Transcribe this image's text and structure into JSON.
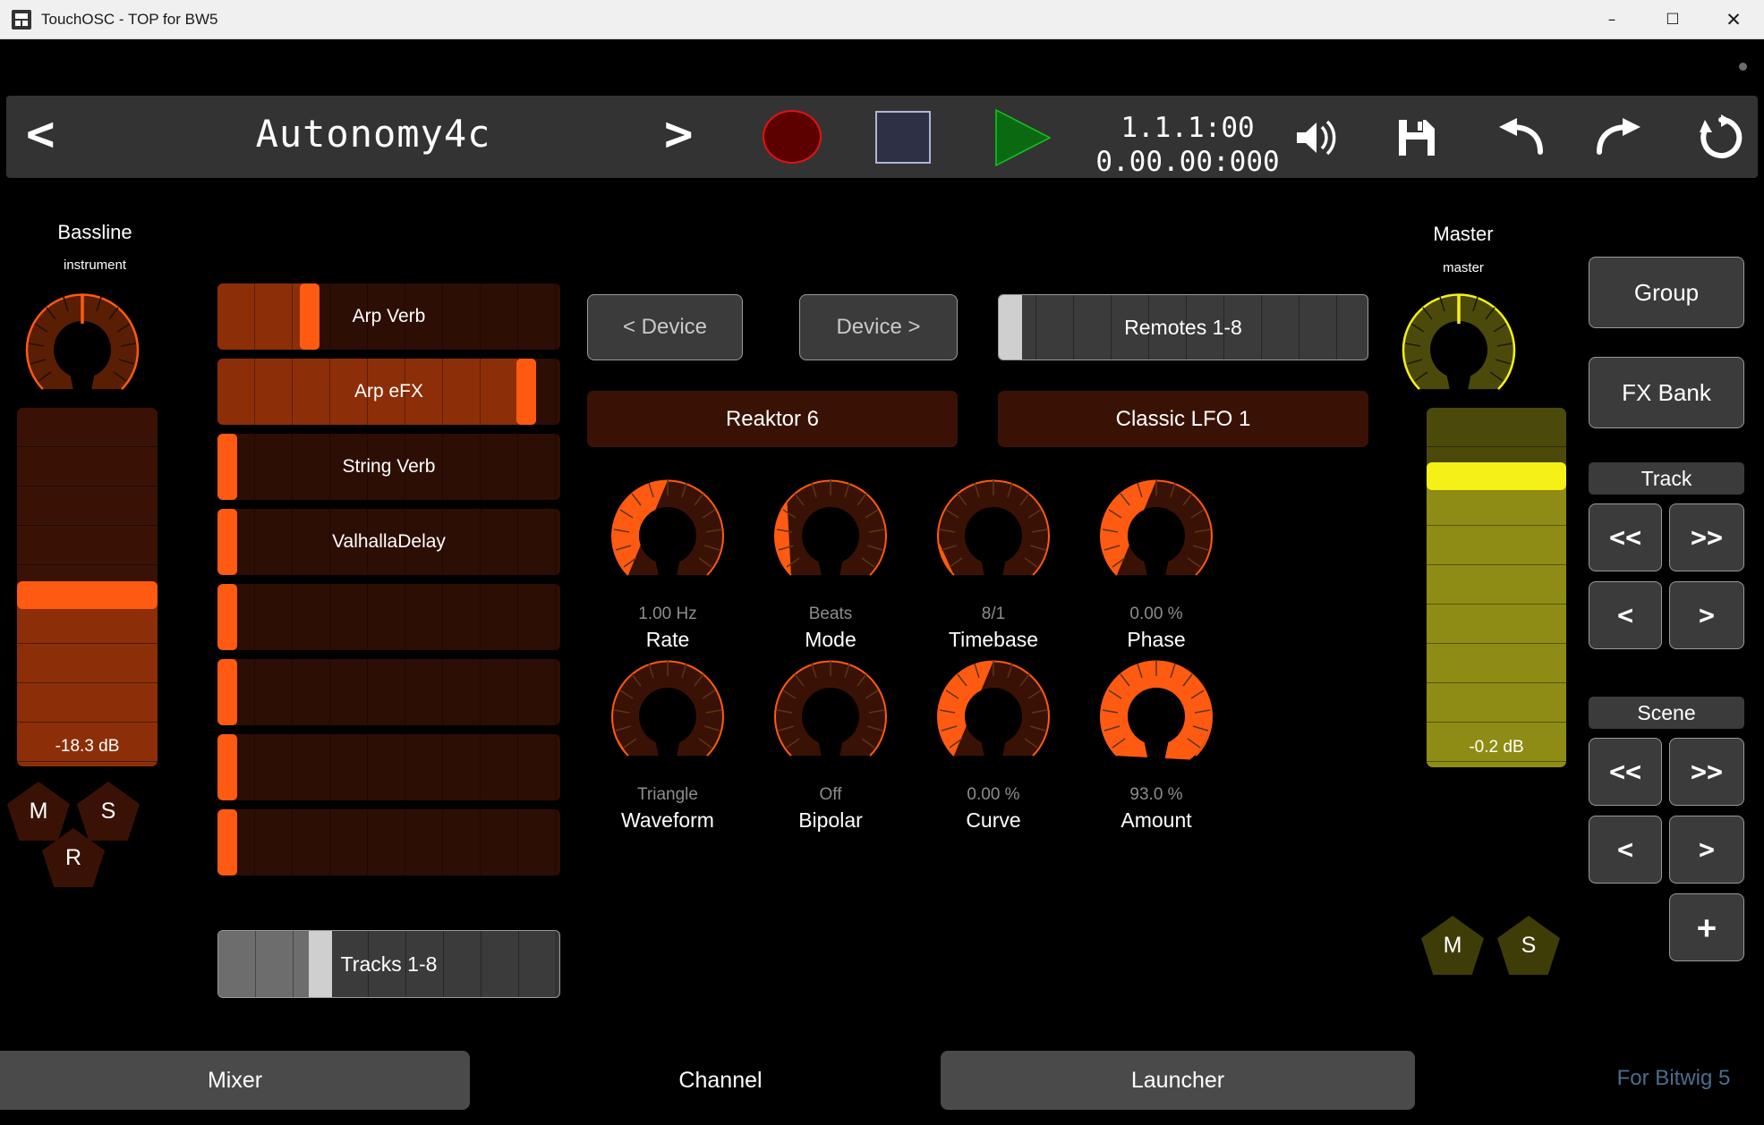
{
  "window": {
    "title": "TouchOSC - TOP for BW5",
    "icon": "app-window-icon",
    "minimize": "–",
    "maximize": "☐",
    "close": "✕"
  },
  "toolbar": {
    "prev_label": "<",
    "next_label": ">",
    "song_title": "Autonomy4c",
    "record_label": "record",
    "stop_label": "stop",
    "play_label": "play",
    "time_bars": "1.1.1:00",
    "time_clock": "0.00.00:000",
    "icons": [
      "metronome-icon",
      "save-icon",
      "undo-icon",
      "redo-icon",
      "loop-icon"
    ]
  },
  "track_strip": {
    "name": "Bassline",
    "type": "instrument",
    "pan_percent": 50,
    "volume_db": "-18.3 dB",
    "volume_percent": 48,
    "mute_label": "M",
    "solo_label": "S",
    "record_label": "R"
  },
  "sends": [
    {
      "label": "Arp Verb",
      "value": 27
    },
    {
      "label": "Arp eFX",
      "value": 90
    },
    {
      "label": "String Verb",
      "value": 0
    },
    {
      "label": "ValhallaDelay",
      "value": 0
    },
    {
      "label": "",
      "value": 0
    },
    {
      "label": "",
      "value": 0
    },
    {
      "label": "",
      "value": 0
    },
    {
      "label": "",
      "value": 0
    }
  ],
  "track_bank": {
    "label": "Tracks 1-8",
    "value": 30
  },
  "device": {
    "prev_label": "< Device",
    "next_label": "Device >",
    "remotes_label": "Remotes 1-8",
    "remotes_value": 4,
    "device_name": "Reaktor 6",
    "modulator_name": "Classic LFO 1"
  },
  "knobs": [
    {
      "name": "Rate",
      "value": "1.00 Hz",
      "percent": 50
    },
    {
      "name": "Mode",
      "value": "Beats",
      "percent": 31
    },
    {
      "name": "Timebase",
      "value": "8/1",
      "percent": 20
    },
    {
      "name": "Phase",
      "value": "0.00 %",
      "percent": 50
    },
    {
      "name": "Waveform",
      "value": "Triangle",
      "percent": 12
    },
    {
      "name": "Bipolar",
      "value": "Off",
      "percent": 0
    },
    {
      "name": "Curve",
      "value": "0.00 %",
      "percent": 50
    },
    {
      "name": "Amount",
      "value": "93.0 %",
      "percent": 93
    }
  ],
  "master": {
    "name": "Master",
    "type": "master",
    "pan_percent": 50,
    "volume_db": "-0.2 dB",
    "volume_percent": 81,
    "mute_label": "M",
    "solo_label": "S"
  },
  "right_panel": {
    "group_label": "Group",
    "fxbank_label": "FX Bank",
    "track_label": "Track",
    "scene_label": "Scene",
    "prev_bank": "<<",
    "next_bank": ">>",
    "prev_step": "<",
    "next_step": ">",
    "add_label": "+"
  },
  "bottom_tabs": {
    "mixer": "Mixer",
    "channel": "Channel",
    "launcher": "Launcher",
    "footer": "For Bitwig 5"
  },
  "colors": {
    "track_accent": "#ff5a12",
    "master_accent": "#f5f117",
    "panel": "#3b3b3b",
    "record": "#e01313",
    "play": "#0a6a12"
  }
}
